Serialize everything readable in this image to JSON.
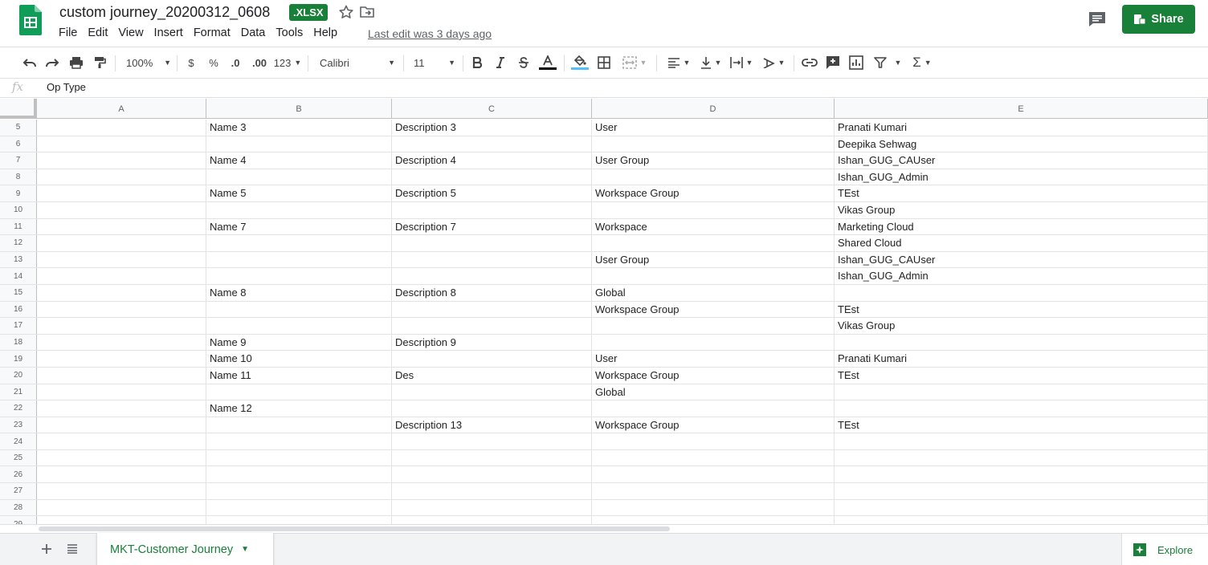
{
  "document": {
    "title": "custom journey_20200312_0608",
    "format_badge": ".XLSX",
    "last_edit": "Last edit was 3 days ago"
  },
  "menu": [
    "File",
    "Edit",
    "View",
    "Insert",
    "Format",
    "Data",
    "Tools",
    "Help"
  ],
  "header": {
    "share_label": "Share"
  },
  "toolbar": {
    "zoom": "100%",
    "currency": "$",
    "percent": "%",
    "decrease_decimal": ".0",
    "increase_decimal": ".00",
    "more_formats": "123",
    "font": "Calibri",
    "font_size": "11",
    "sum": "Σ"
  },
  "formula_bar": {
    "fx": "fx",
    "value": "Op Type"
  },
  "columns": [
    "A",
    "B",
    "C",
    "D",
    "E"
  ],
  "rows": [
    {
      "n": "5",
      "b": "Name 3",
      "c": "Description 3",
      "d": "User",
      "e": "Pranati Kumari"
    },
    {
      "n": "6",
      "b": "",
      "c": "",
      "d": "",
      "e": "Deepika Sehwag"
    },
    {
      "n": "7",
      "b": "Name 4",
      "c": "Description 4",
      "d": "User Group",
      "e": "Ishan_GUG_CAUser"
    },
    {
      "n": "8",
      "b": "",
      "c": "",
      "d": "",
      "e": "Ishan_GUG_Admin"
    },
    {
      "n": "9",
      "b": "Name 5",
      "c": "Description 5",
      "d": "Workspace Group",
      "e": "TEst"
    },
    {
      "n": "10",
      "b": "",
      "c": "",
      "d": "",
      "e": "Vikas Group"
    },
    {
      "n": "11",
      "b": "Name 7",
      "c": "Description 7",
      "d": "Workspace",
      "e": "Marketing Cloud"
    },
    {
      "n": "12",
      "b": "",
      "c": "",
      "d": "",
      "e": "Shared Cloud"
    },
    {
      "n": "13",
      "b": "",
      "c": "",
      "d": "User Group",
      "e": "Ishan_GUG_CAUser"
    },
    {
      "n": "14",
      "b": "",
      "c": "",
      "d": "",
      "e": "Ishan_GUG_Admin"
    },
    {
      "n": "15",
      "b": "Name 8",
      "c": "Description 8",
      "d": "Global",
      "e": ""
    },
    {
      "n": "16",
      "b": "",
      "c": "",
      "d": "Workspace Group",
      "e": "TEst"
    },
    {
      "n": "17",
      "b": "",
      "c": "",
      "d": "",
      "e": "Vikas Group"
    },
    {
      "n": "18",
      "b": "Name 9",
      "c": "Description 9",
      "d": "",
      "e": ""
    },
    {
      "n": "19",
      "b": "Name 10",
      "c": "",
      "d": "User",
      "e": "Pranati Kumari"
    },
    {
      "n": "20",
      "b": "Name 11",
      "c": "Des",
      "d": "Workspace Group",
      "e": "TEst"
    },
    {
      "n": "21",
      "b": "",
      "c": "",
      "d": "Global",
      "e": ""
    },
    {
      "n": "22",
      "b": "Name 12",
      "c": "",
      "d": "",
      "e": ""
    },
    {
      "n": "23",
      "b": "",
      "c": "Description 13",
      "d": "Workspace Group",
      "e": "TEst"
    },
    {
      "n": "24",
      "b": "",
      "c": "",
      "d": "",
      "e": ""
    },
    {
      "n": "25",
      "b": "",
      "c": "",
      "d": "",
      "e": ""
    },
    {
      "n": "26",
      "b": "",
      "c": "",
      "d": "",
      "e": ""
    },
    {
      "n": "27",
      "b": "",
      "c": "",
      "d": "",
      "e": ""
    },
    {
      "n": "28",
      "b": "",
      "c": "",
      "d": "",
      "e": ""
    },
    {
      "n": "29",
      "b": "",
      "c": "",
      "d": "",
      "e": ""
    }
  ],
  "sheets": {
    "active": "MKT-Customer Journey"
  },
  "explore_label": "Explore",
  "colors": {
    "brand_green": "#188038",
    "text_color_bar": "#000000",
    "fill_color_bar": "#4fc3f7"
  }
}
